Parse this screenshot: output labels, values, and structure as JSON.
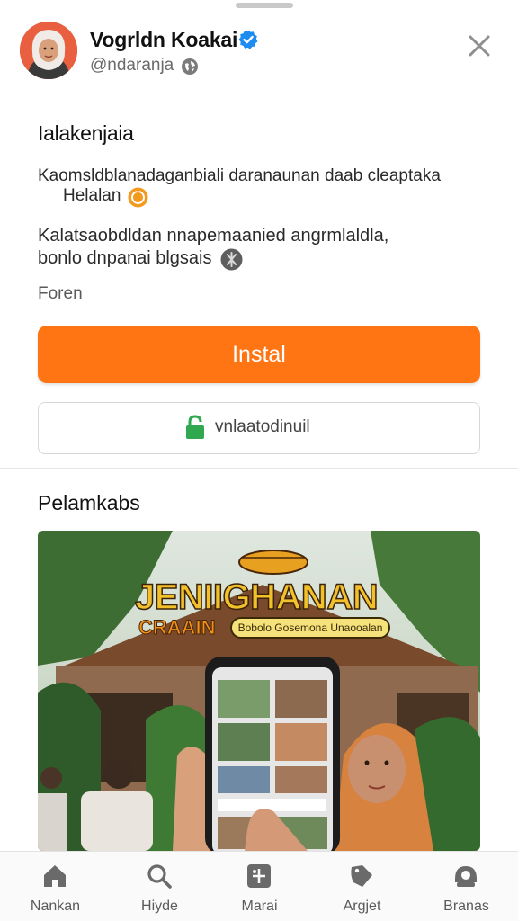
{
  "header": {
    "profile_name": "Vogrldn Koakai",
    "handle": "@ndaranja",
    "close_icon": "close-icon",
    "verified_icon": "verified-badge-icon"
  },
  "content": {
    "section_title": "Ialakenjaia",
    "description_line1": "Kaomsldblanadaganbiali daranaunan daab cleaptaka",
    "description_line1b": "Helalan",
    "description_line2": "Kalatsaobdldan nnapemaanied angrmlaldla,",
    "description_line2b": "bonlo dnpanai blgsais",
    "meta_text": "Foren"
  },
  "actions": {
    "install_label": "Instal",
    "secondary_label": "vnlaatodinuil",
    "accent_color": "#ff7413",
    "lock_color": "#2fa84f"
  },
  "preview": {
    "title": "Pelamkabs",
    "banner_title": "JENIIGHANAN",
    "banner_sub": "CRAAIN",
    "banner_tag": "Bobolo Gosemona Unaooalan"
  },
  "tabbar": {
    "items": [
      {
        "label": "Nankan",
        "icon": "home-icon"
      },
      {
        "label": "Hiyde",
        "icon": "search-icon"
      },
      {
        "label": "Marai",
        "icon": "apps-icon"
      },
      {
        "label": "Argjet",
        "icon": "tag-icon"
      },
      {
        "label": "Branas",
        "icon": "profile-icon"
      }
    ]
  }
}
